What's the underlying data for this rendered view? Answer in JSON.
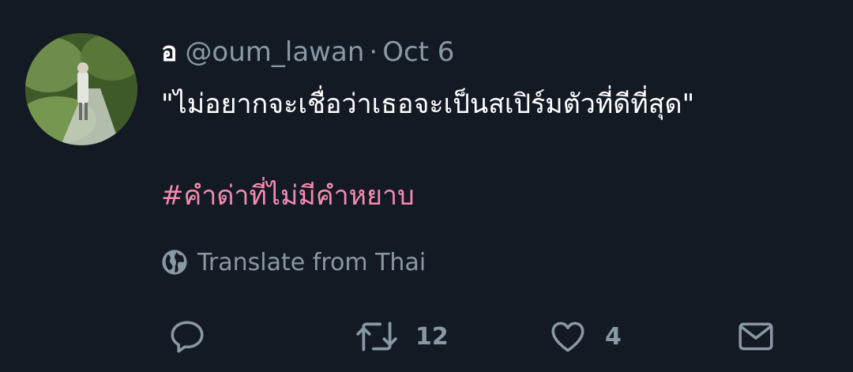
{
  "tweet": {
    "display_name": "อ",
    "handle": "@oum_lawan",
    "separator": "·",
    "date": "Oct 6",
    "text": "\"ไม่อยากจะเชื่อว่าเธอจะเป็นสเปิร์มตัวที่ดีที่สุด\"",
    "hashtag": "#คำด่าที่ไม่มีคำหยาบ",
    "translate_label": "Translate from Thai",
    "retweet_count": "12",
    "like_count": "4"
  },
  "icons": {
    "reply": "reply-icon",
    "retweet": "retweet-icon",
    "like": "heart-icon",
    "dm": "mail-icon",
    "translate": "globe-icon"
  },
  "colors": {
    "background": "#131a24",
    "text": "#ffffff",
    "secondary": "#8899a6",
    "hashtag": "#f78bb0"
  }
}
